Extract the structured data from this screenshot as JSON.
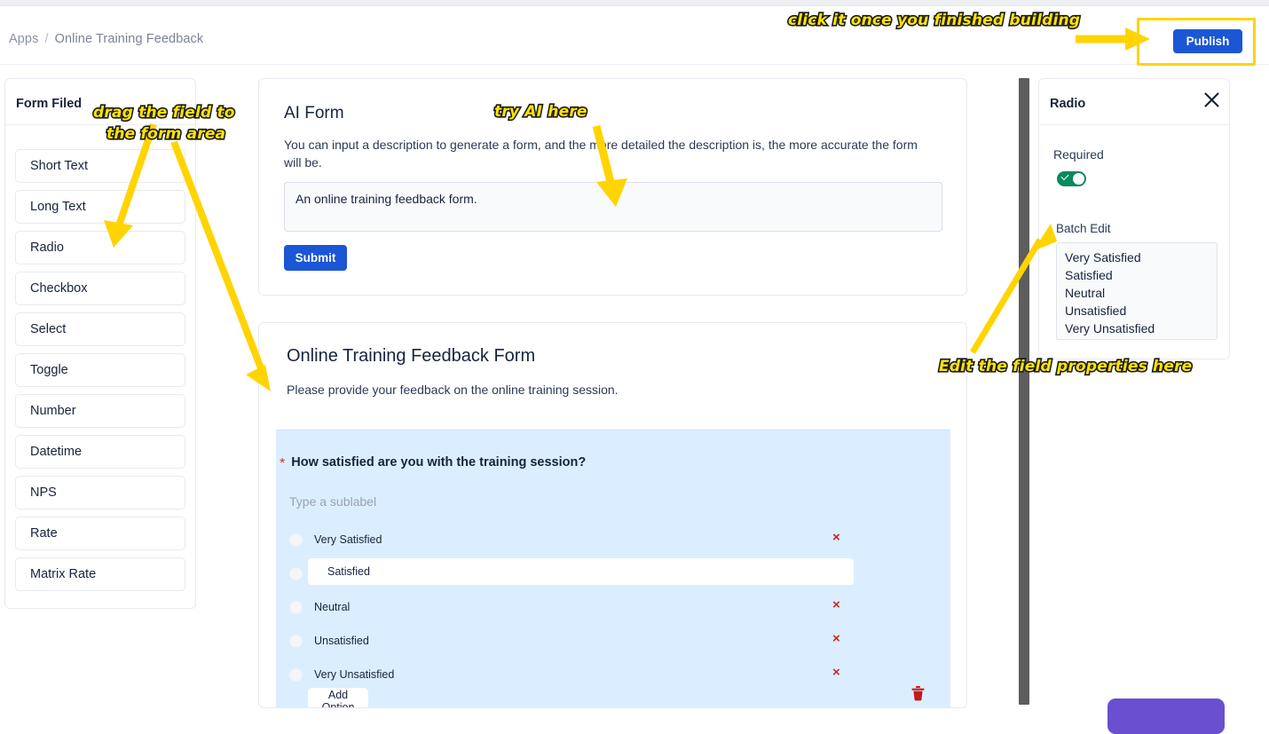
{
  "header": {
    "breadcrumb": {
      "root": "Apps",
      "separator": "/",
      "current": "Online Training Feedback"
    },
    "publish_label": "Publish"
  },
  "sidebar": {
    "title": "Form Filed",
    "items": [
      {
        "label": "Short Text"
      },
      {
        "label": "Long Text"
      },
      {
        "label": "Radio"
      },
      {
        "label": "Checkbox"
      },
      {
        "label": "Select"
      },
      {
        "label": "Toggle"
      },
      {
        "label": "Number"
      },
      {
        "label": "Datetime"
      },
      {
        "label": "NPS"
      },
      {
        "label": "Rate"
      },
      {
        "label": "Matrix Rate"
      }
    ]
  },
  "ai_form": {
    "title": "AI Form",
    "description": "You can input a description to generate a form, and the more detailed the description is, the more accurate the form will be.",
    "prompt_value": "An online training feedback form.",
    "prompt_placeholder": "",
    "submit_label": "Submit"
  },
  "form_preview": {
    "title": "Online Training Feedback Form",
    "subtitle": "Please provide your feedback on the online training session.",
    "field": {
      "required_marker": "*",
      "label": "How satisfied are you with the training session?",
      "sublabel_placeholder": "Type a sublabel",
      "options": [
        {
          "label": "Very Satisfied",
          "editing": false
        },
        {
          "label": "Satisfied",
          "editing": true
        },
        {
          "label": "Neutral",
          "editing": false
        },
        {
          "label": "Unsatisfied",
          "editing": false
        },
        {
          "label": "Very Unsatisfied",
          "editing": false
        }
      ],
      "delete_option_icon": "×",
      "add_option_label": "Add Option",
      "delete_field_icon": "trash-icon"
    }
  },
  "properties_panel": {
    "title": "Radio",
    "close_icon": "close-icon",
    "required_label": "Required",
    "required_value": true,
    "batch_edit_label": "Batch Edit",
    "batch_edit_value": "Very Satisfied\nSatisfied\nNeutral\nUnsatisfied\nVery Unsatisfied"
  },
  "annotations": [
    {
      "text": "click it once you finished building"
    },
    {
      "text": "drag the field to"
    },
    {
      "text": "the form area"
    },
    {
      "text": "try AI here"
    },
    {
      "text": "Edit the field properties here"
    }
  ],
  "colors": {
    "accent_blue": "#1a56d6",
    "highlight_yellow": "#ffd400",
    "field_block_blue": "#dbeeff",
    "toggle_green": "#0a8a5f",
    "danger_red": "#d42222"
  }
}
